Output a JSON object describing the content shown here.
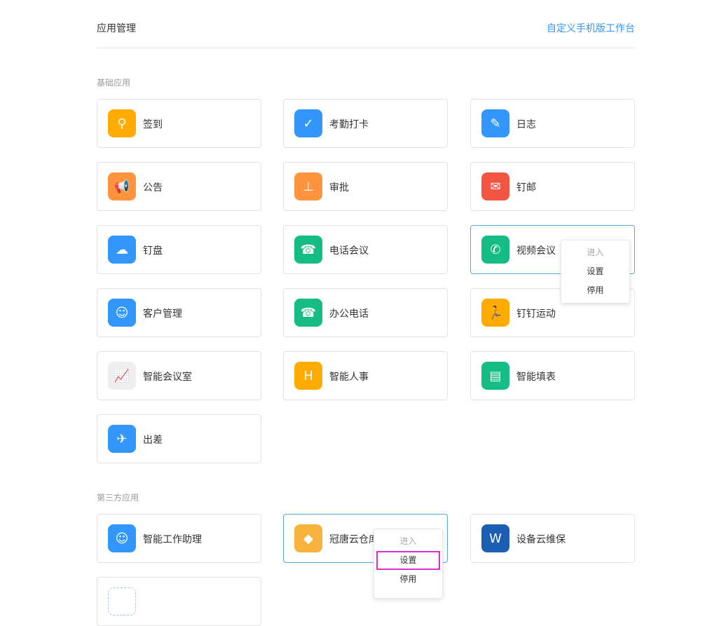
{
  "header": {
    "title": "应用管理",
    "custom_link": "自定义手机版工作台"
  },
  "sections": {
    "basic": "基础应用",
    "third": "第三方应用"
  },
  "basic_apps": [
    {
      "label": "签到",
      "color": "#ffab00",
      "icon": "location-pin-icon",
      "glyph": "⚲"
    },
    {
      "label": "考勤打卡",
      "color": "#3296fa",
      "icon": "check-pin-icon",
      "glyph": "✓"
    },
    {
      "label": "日志",
      "color": "#3296fa",
      "icon": "notebook-icon",
      "glyph": "✎"
    },
    {
      "label": "公告",
      "color": "#ff943e",
      "icon": "megaphone-icon",
      "glyph": "📢"
    },
    {
      "label": "审批",
      "color": "#ff943e",
      "icon": "stamp-icon",
      "glyph": "⊥"
    },
    {
      "label": "钉邮",
      "color": "#f25643",
      "icon": "mail-icon",
      "glyph": "✉"
    },
    {
      "label": "钉盘",
      "color": "#3296fa",
      "icon": "cloud-icon",
      "glyph": "☁"
    },
    {
      "label": "电话会议",
      "color": "#15bc83",
      "icon": "conference-call-icon",
      "glyph": "☎"
    },
    {
      "label": "视频会议",
      "color": "#15bc83",
      "icon": "video-call-icon",
      "glyph": "✆"
    },
    {
      "label": "客户管理",
      "color": "#3296fa",
      "icon": "customer-icon",
      "glyph": "☺"
    },
    {
      "label": "办公电话",
      "color": "#15bc83",
      "icon": "office-phone-icon",
      "glyph": "☎"
    },
    {
      "label": "钉钉运动",
      "color": "#ffab00",
      "icon": "running-icon",
      "glyph": "🏃"
    },
    {
      "label": "智能会议室",
      "color": "#eeeeee",
      "icon": "presentation-board-icon",
      "glyph": "📈"
    },
    {
      "label": "智能人事",
      "color": "#ffab00",
      "icon": "hr-icon",
      "glyph": "H"
    },
    {
      "label": "智能填表",
      "color": "#15bc83",
      "icon": "form-icon",
      "glyph": "▤"
    },
    {
      "label": "出差",
      "color": "#3296fa",
      "icon": "luggage-icon",
      "glyph": "✈"
    }
  ],
  "third_apps": [
    {
      "label": "智能工作助理",
      "color": "#3296fa",
      "icon": "robot-icon",
      "glyph": "☺"
    },
    {
      "label": "冠唐云仓库",
      "color": "#f7b23b",
      "icon": "warehouse-icon",
      "glyph": "◆"
    },
    {
      "label": "设备云维保",
      "color": "#1a5fb4",
      "icon": "w-logo-icon",
      "glyph": "W"
    },
    {
      "label": "",
      "color": "#ffffff",
      "icon": "app-icon",
      "glyph": ""
    }
  ],
  "menu": {
    "enter": "进入",
    "settings": "设置",
    "disable": "停用"
  }
}
